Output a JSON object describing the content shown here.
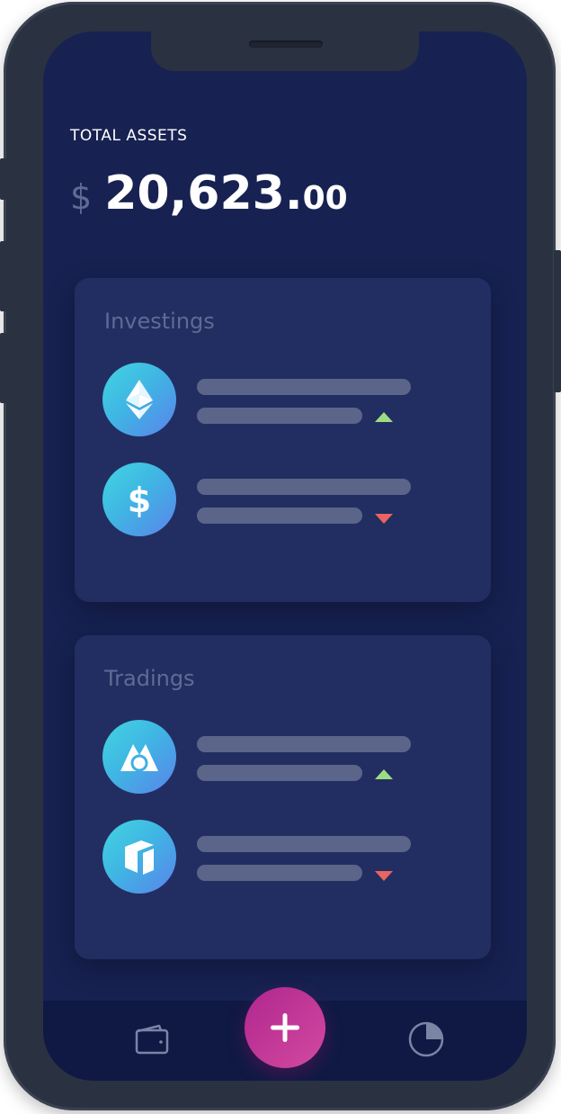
{
  "header": {
    "total_label": "TOTAL ASSETS",
    "currency_symbol": "$",
    "amount_main": "20,623.",
    "amount_decimals": "00"
  },
  "investings": {
    "title": "Investings",
    "items": [
      {
        "icon": "ethereum-icon",
        "trend": "up"
      },
      {
        "icon": "dollar-icon",
        "trend": "down"
      }
    ]
  },
  "tradings": {
    "title": "Tradings",
    "items": [
      {
        "icon": "mountain-coin-icon",
        "trend": "up"
      },
      {
        "icon": "neo-coin-icon",
        "trend": "down"
      }
    ]
  },
  "bottom_nav": {
    "left_icon": "wallet-icon",
    "center_icon": "plus-icon",
    "right_icon": "pie-chart-icon"
  },
  "colors": {
    "background": "#172252",
    "card": "#222e61",
    "up": "#9edc84",
    "down": "#ea6460",
    "accent": "#c2378f"
  }
}
